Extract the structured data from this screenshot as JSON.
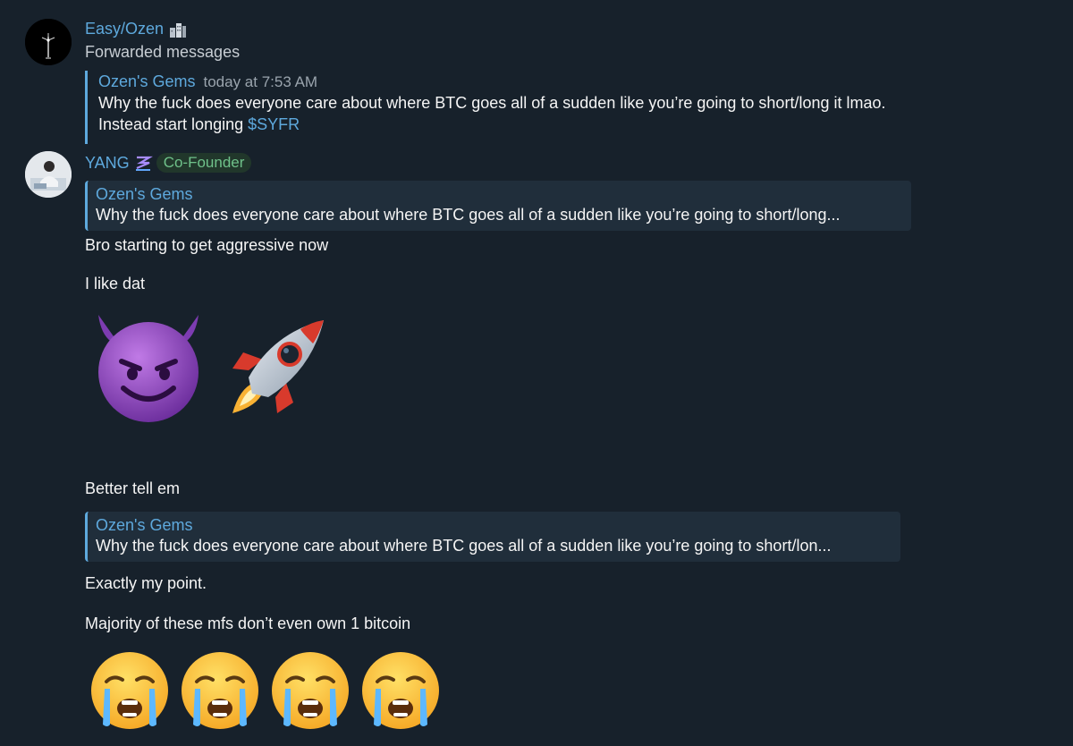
{
  "messages": [
    {
      "sender": "Easy/Ozen",
      "subtitle": "Forwarded messages",
      "forwarded": {
        "from": "Ozen's Gems",
        "time": "today at 7:53 AM",
        "text": "Why the fuck does everyone care about where BTC goes all of a sudden like you’re going to short/long it lmao. Instead start longing ",
        "link": "$SYFR"
      }
    },
    {
      "sender": "YANG",
      "badge": "Co-Founder",
      "reply_1": {
        "from": "Ozen's Gems",
        "text": "Why the fuck does everyone care about where BTC goes all of a sudden like you’re going to short/long..."
      },
      "text_1": "Bro starting to get aggressive now",
      "text_2": "I like dat",
      "emoji_row_1": [
        "smiling-devil-emoji",
        "rocket-emoji"
      ],
      "text_3": "Better tell em",
      "reply_2": {
        "from": "Ozen's Gems",
        "text": "Why the fuck does everyone care about where BTC goes all of a sudden like you’re going to short/lon..."
      },
      "text_4": "Exactly my point.",
      "text_5": "Majority of these mfs don’t even own 1 bitcoin",
      "emoji_row_2": [
        "loudly-crying-emoji",
        "loudly-crying-emoji",
        "loudly-crying-emoji",
        "loudly-crying-emoji"
      ]
    }
  ],
  "colors": {
    "background": "#17212b",
    "accent": "#5ea9dd",
    "badge_text": "#6fc18a",
    "reply_bg": "#202e3b"
  }
}
